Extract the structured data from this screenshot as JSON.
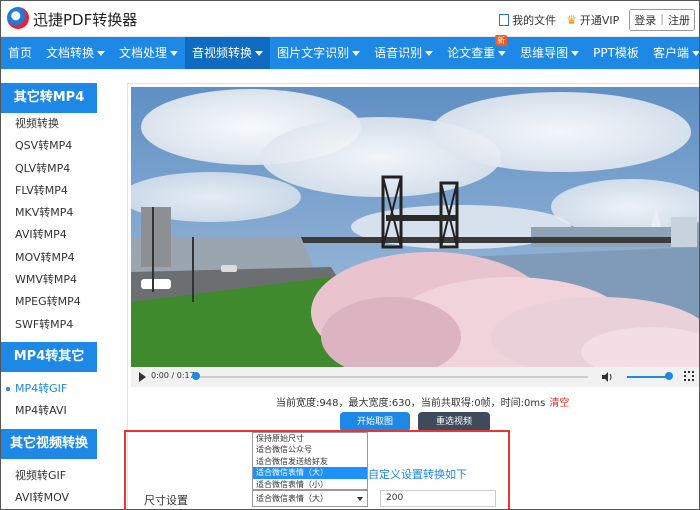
{
  "header": {
    "brand": "迅捷PDF转换器",
    "my_files": "我的文件",
    "vip": "开通VIP",
    "login": "登录",
    "register": "注册"
  },
  "nav": {
    "items": [
      {
        "label": "首页"
      },
      {
        "label": "文档转换"
      },
      {
        "label": "文档处理"
      },
      {
        "label": "音视频转换"
      },
      {
        "label": "图片文字识别"
      },
      {
        "label": "语音识别"
      },
      {
        "label": "论文查重"
      },
      {
        "label": "思维导图"
      },
      {
        "label": "PPT模板"
      },
      {
        "label": "客户端"
      }
    ],
    "new_badge": "新"
  },
  "sidebar": {
    "section1": "其它转MP4",
    "items1": [
      "视频转换",
      "QSV转MP4",
      "QLV转MP4",
      "FLV转MP4",
      "MKV转MP4",
      "AVI转MP4",
      "MOV转MP4",
      "WMV转MP4",
      "MPEG转MP4",
      "SWF转MP4"
    ],
    "section2": "MP4转其它",
    "items2": [
      "MP4转GIF",
      "MP4转AVI"
    ],
    "section3": "其它视频转换",
    "items3": [
      "视频转GIF",
      "AVI转MOV"
    ]
  },
  "player": {
    "time": "0:00 / 0:17",
    "progress": 0.0,
    "volume": 0.9
  },
  "info": {
    "text": "当前宽度:948，最大宽度:630，当前共取得:0帧，时间:0ms",
    "clear": "清空"
  },
  "buttons": {
    "start": "开始取图",
    "reselect": "重选视频"
  },
  "settings": {
    "custom_text": "自定义设置转换如下",
    "size_label": "尺寸设置",
    "selected": "适合微信表情（大）",
    "value": "200",
    "options": [
      "保持原始尺寸",
      "适合微信公众号",
      "适合微信发送给好友",
      "适合微信表情（大）",
      "适合微信表情（小）"
    ]
  },
  "colors": {
    "primary": "#1d88e5",
    "dark_button": "#3d4b5c",
    "red": "#e33333"
  }
}
